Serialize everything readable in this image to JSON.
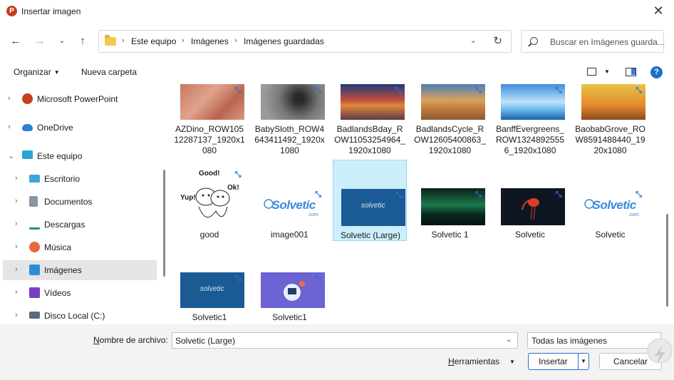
{
  "window": {
    "title": "Insertar imagen",
    "app_icon_letter": "P"
  },
  "address": {
    "breadcrumb": [
      "Este equipo",
      "Imágenes",
      "Imágenes guardadas"
    ]
  },
  "search": {
    "placeholder": "Buscar en Imágenes guarda..."
  },
  "toolbar": {
    "organize": "Organizar",
    "new_folder": "Nueva carpeta",
    "help": "?"
  },
  "sidebar": {
    "items": [
      {
        "label": "Microsoft PowerPoint",
        "icon": "powerpoint-icon",
        "level": 0,
        "selected": false
      },
      {
        "label": "OneDrive",
        "icon": "cloud-icon",
        "level": 0,
        "selected": false
      },
      {
        "label": "Este equipo",
        "icon": "computer-icon",
        "level": 0,
        "selected": false,
        "expanded": true
      },
      {
        "label": "Escritorio",
        "icon": "desktop-icon",
        "level": 1,
        "selected": false
      },
      {
        "label": "Documentos",
        "icon": "documents-icon",
        "level": 1,
        "selected": false
      },
      {
        "label": "Descargas",
        "icon": "download-icon",
        "level": 1,
        "selected": false
      },
      {
        "label": "Música",
        "icon": "music-icon",
        "level": 1,
        "selected": false
      },
      {
        "label": "Imágenes",
        "icon": "pictures-icon",
        "level": 1,
        "selected": true
      },
      {
        "label": "Vídeos",
        "icon": "videos-icon",
        "level": 1,
        "selected": false
      },
      {
        "label": "Disco Local (C:)",
        "icon": "drive-icon",
        "level": 1,
        "selected": false
      }
    ]
  },
  "files": [
    {
      "name": "AZDino_ROW10512287137_1920x1080",
      "lines": [
        "AZDino_ROW105",
        "12287137_1920x1",
        "080"
      ],
      "thumb": "dino"
    },
    {
      "name": "BabySloth_ROW4643411492_1920x1080",
      "lines": [
        "BabySloth_ROW4",
        "643411492_1920x",
        "1080"
      ],
      "thumb": "sloth"
    },
    {
      "name": "BadlandsBday_ROW11053254964_1920x1080",
      "lines": [
        "BadlandsBday_R",
        "OW11053254964_",
        "1920x1080"
      ],
      "thumb": "badlands1"
    },
    {
      "name": "BadlandsCycle_ROW12605400863_1920x1080",
      "lines": [
        "BadlandsCycle_R",
        "OW12605400863_",
        "1920x1080"
      ],
      "thumb": "badlands2"
    },
    {
      "name": "BanffEvergreens_ROW13248925556_1920x1080",
      "lines": [
        "BanffEvergreens_",
        "ROW1324892555",
        "6_1920x1080"
      ],
      "thumb": "banff"
    },
    {
      "name": "BaobabGrove_ROW8591488440_1920x1080",
      "lines": [
        "BaobabGrove_RO",
        "W8591488440_19",
        "20x1080"
      ],
      "thumb": "baobab"
    },
    {
      "name": "good",
      "lines": [
        "good"
      ],
      "thumb": "good"
    },
    {
      "name": "image001",
      "lines": [
        "image001"
      ],
      "thumb": "solvlogo"
    },
    {
      "name": "Solvetic (Large)",
      "lines": [
        "Solvetic (Large)"
      ],
      "thumb": "solvblue",
      "selected": true
    },
    {
      "name": "Solvetic 1",
      "lines": [
        "Solvetic 1"
      ],
      "thumb": "aurora"
    },
    {
      "name": "Solvetic",
      "lines": [
        "Solvetic"
      ],
      "thumb": "ibis"
    },
    {
      "name": "Solvetic",
      "lines": [
        "Solvetic"
      ],
      "thumb": "solvlogo"
    },
    {
      "name": "Solvetic1",
      "lines": [
        "Solvetic1"
      ],
      "thumb": "solvblue"
    },
    {
      "name": "Solvetic1",
      "lines": [
        "Solvetic1"
      ],
      "thumb": "purple"
    }
  ],
  "thumb_text": {
    "good_words": [
      "Good!",
      "Ok!",
      "Yup!"
    ],
    "solvetic_word": "solvetic",
    "solvetic_logo": "Solvetic",
    "solvetic_com": ".com"
  },
  "bottom": {
    "filename_label_pre": "N",
    "filename_label_rest": "ombre de archivo:",
    "filename_value": "Solvetic (Large)",
    "filetype_value": "Todas las imágenes",
    "tools_pre": "H",
    "tools_rest": "erramientas",
    "insert_label": "Insertar",
    "cancel_label": "Cancelar"
  },
  "colors": {
    "accent": "#2b6fd6",
    "selection": "#cdeefb",
    "sidebar_selected": "#e5e5e5",
    "footer": "#f3f3f3"
  }
}
